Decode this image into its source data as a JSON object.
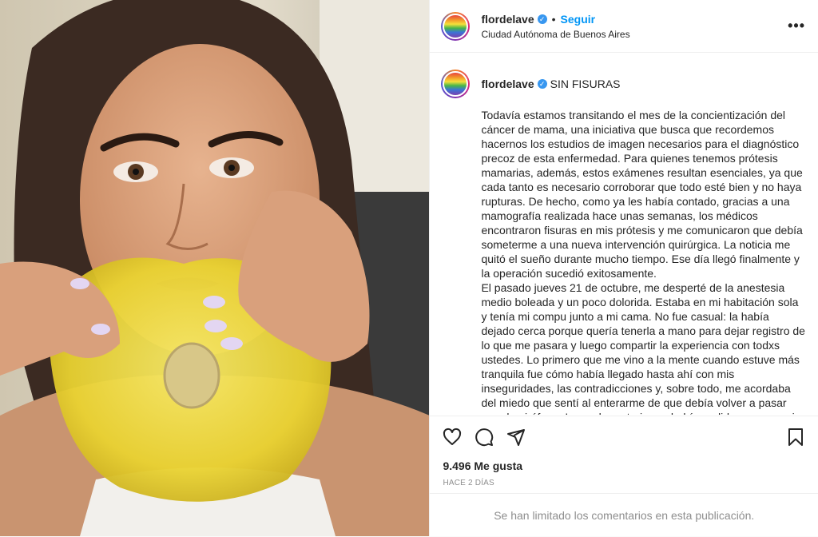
{
  "post": {
    "username": "flordelave",
    "follow_label": "Seguir",
    "separator": "•",
    "location": "Ciudad Autónoma de Buenos Aires",
    "more_icon": "more-horizontal-icon",
    "verified_icon": "verified-badge-icon",
    "more_text": "•••",
    "verified_text": "✓"
  },
  "caption": {
    "username": "flordelave",
    "title": "SIN FISURAS",
    "text": "Todavía estamos transitando el mes de la concientización del cáncer de mama, una iniciativa que busca que recordemos hacernos los estudios de imagen necesarios para el diagnóstico precoz de esta enfermedad. Para quienes tenemos prótesis mamarias, además, estos exámenes resultan esenciales, ya que cada tanto es necesario corroborar que todo esté bien y no haya rupturas. De hecho, como ya les había contado, gracias a una mamografía realizada hace unas semanas, los médicos encontraron fisuras en mis prótesis y me comunicaron que debía someterme a una nueva intervención quirúrgica. La noticia me quitó el sueño durante mucho tiempo. Ese día llegó finalmente y la operación sucedió exitosamente.\nEl pasado jueves 21 de octubre, me desperté de la anestesia medio boleada y un poco dolorida. Estaba en mi habitación sola y tenía mi compu junto a mi cama. No fue casual: la había dejado cerca porque quería tenerla a mano para dejar registro de lo que me pasara y luego compartir la experiencia con todxs ustedes. Lo primero que me vino a la mente cuando estuve más tranquila fue cómo había llegado hasta ahí con mis inseguridades, las contradicciones y, sobre todo, me acordaba del miedo que sentí al enterarme de que debía volver a pasar por el quirófano. La noche anterior no había podido pegar un ojo, pensaba en"
  },
  "actions": {
    "icons": [
      "heart-icon",
      "comment-icon",
      "share-icon",
      "bookmark-icon"
    ]
  },
  "likes": "9.496 Me gusta",
  "timestamp": "HACE 2 DÍAS",
  "comments_notice": "Se han limitado los comentarios en esta publicación.",
  "colors": {
    "link": "#0095f6",
    "verified": "#3897f0",
    "muted": "#8e8e8e",
    "implant": "#f2dc3a"
  }
}
